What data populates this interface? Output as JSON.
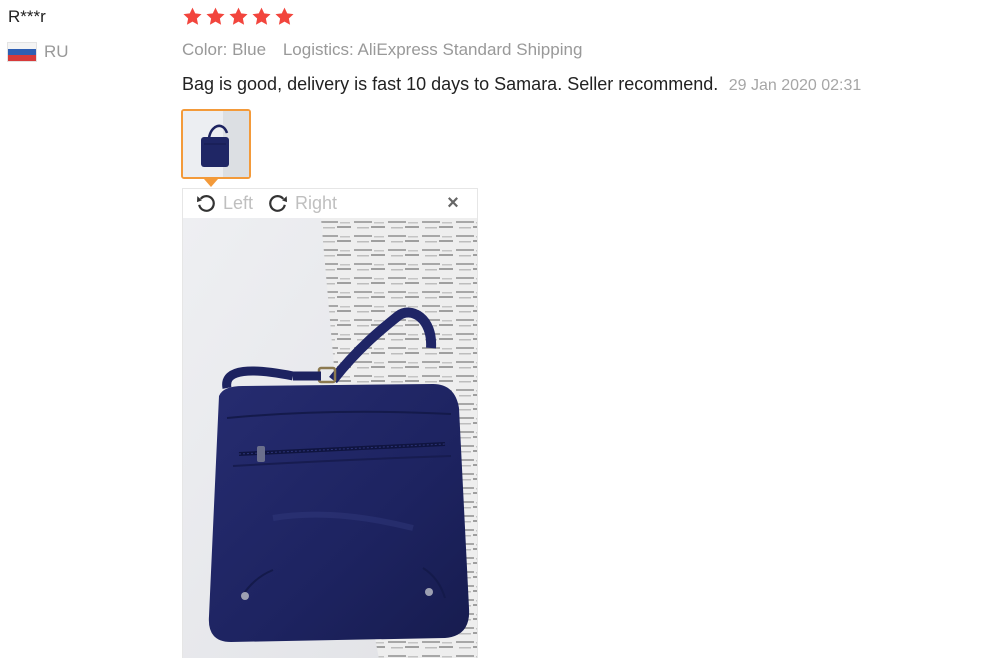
{
  "user": {
    "name": "R***r",
    "country_code": "RU",
    "flag": "russia-flag-icon"
  },
  "rating": {
    "stars": 5,
    "max": 5,
    "color": "#f2453d"
  },
  "attributes": {
    "color": "Color: Blue",
    "logistics": "Logistics: AliExpress Standard Shipping"
  },
  "review": {
    "text": "Bag is good, delivery is fast 10 days to Samara. Seller recommend.",
    "date": "29 Jan 2020 02:31"
  },
  "viewer": {
    "rotate_left_label": "Left",
    "rotate_right_label": "Right",
    "close_symbol": "×",
    "thumbnail_border_color": "#f39a3a"
  },
  "photo": {
    "subject": "navy blue crossbody bag",
    "bag_color": "#1d2360"
  }
}
